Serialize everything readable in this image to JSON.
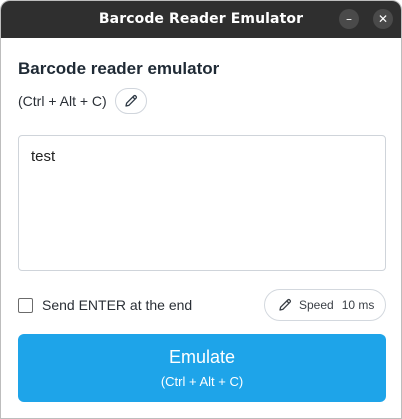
{
  "window": {
    "title": "Barcode Reader Emulator",
    "minimize_glyph": "–",
    "close_glyph": "✕"
  },
  "main": {
    "heading": "Barcode reader emulator",
    "shortcut": "(Ctrl + Alt + C)",
    "edit_icon": "pencil-icon",
    "text_value": "test",
    "send_enter_label": "Send ENTER at the end",
    "send_enter_checked": false,
    "speed_label": "Speed",
    "speed_value": "10 ms",
    "emulate_label": "Emulate",
    "emulate_shortcut": "(Ctrl + Alt + C)"
  },
  "colors": {
    "titlebar": "#2f2f2f",
    "accent": "#1ea4e9",
    "heading_text": "#1f2a35"
  }
}
